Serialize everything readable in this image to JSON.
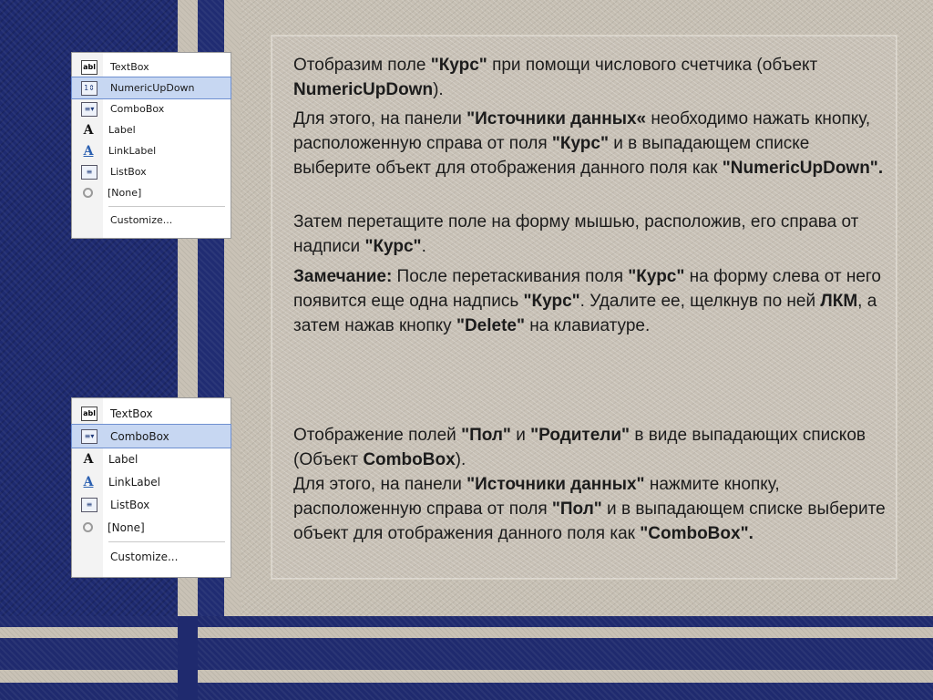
{
  "menu1": {
    "items": [
      {
        "label": "TextBox",
        "icon": "textbox-icon"
      },
      {
        "label": "NumericUpDown",
        "icon": "numericupdown-icon",
        "selected": true
      },
      {
        "label": "ComboBox",
        "icon": "combobox-icon"
      },
      {
        "label": "Label",
        "icon": "label-icon"
      },
      {
        "label": "LinkLabel",
        "icon": "linklabel-icon"
      },
      {
        "label": "ListBox",
        "icon": "listbox-icon"
      },
      {
        "label": "[None]",
        "icon": "none-icon"
      }
    ],
    "customize": "Customize..."
  },
  "menu2": {
    "items": [
      {
        "label": "TextBox",
        "icon": "textbox-icon"
      },
      {
        "label": "ComboBox",
        "icon": "combobox-icon",
        "selected": true
      },
      {
        "label": "Label",
        "icon": "label-icon"
      },
      {
        "label": "LinkLabel",
        "icon": "linklabel-icon"
      },
      {
        "label": "ListBox",
        "icon": "listbox-icon"
      },
      {
        "label": "[None]",
        "icon": "none-icon"
      }
    ],
    "customize": "Customize..."
  },
  "text": {
    "p1": {
      "t1": "Отобразим поле ",
      "b1": "\"Курс\"",
      "t2": " при помощи числового счетчика (объект ",
      "b2": "NumericUpDown",
      "t3": ")."
    },
    "p2": {
      "t1": "Для этого, на панели ",
      "b1": "\"Источники данных«",
      "t2": " необходимо нажать кнопку, расположенную справа от поля ",
      "b2": "\"Курс\"",
      "t3": " и в выпадающем списке выберите объект для отображения данного поля как ",
      "b3": "\"NumericUpDown\"."
    },
    "p3": {
      "t1": "Затем перетащите поле на форму мышью, расположив, его справа от надписи ",
      "b1": "\"Курс\"",
      "t2": "."
    },
    "p4": {
      "b1": "Замечание:",
      "t1": " После перетаскивания поля ",
      "b2": "\"Курс\"",
      "t2": " на форму слева от него появится еще одна надпись ",
      "b3": "\"Курс\"",
      "t3": ". Удалите ее, щелкнув по ней ",
      "b4": "ЛКМ",
      "t4": ", а затем нажав кнопку ",
      "b5": "\"Delete\"",
      "t5": " на клавиатуре."
    },
    "p5": {
      "t1": "Отображение полей  ",
      "b1": "\"Пол\"",
      "t2": " и ",
      "b2": "\"Родители\"",
      "t3": " в виде выпадающих списков (Объект ",
      "b3": "ComboBox",
      "t4": ")."
    },
    "p6": {
      "t1": "Для этого, на панели ",
      "b1": "\"Источники данных\"",
      "t2": " нажмите кнопку, расположенную справа от поля ",
      "b2": "\"Пол\"",
      "t3": " и в выпадающем списке выберите объект для отображения данного поля как ",
      "b3": "\"ComboBox\"."
    }
  }
}
